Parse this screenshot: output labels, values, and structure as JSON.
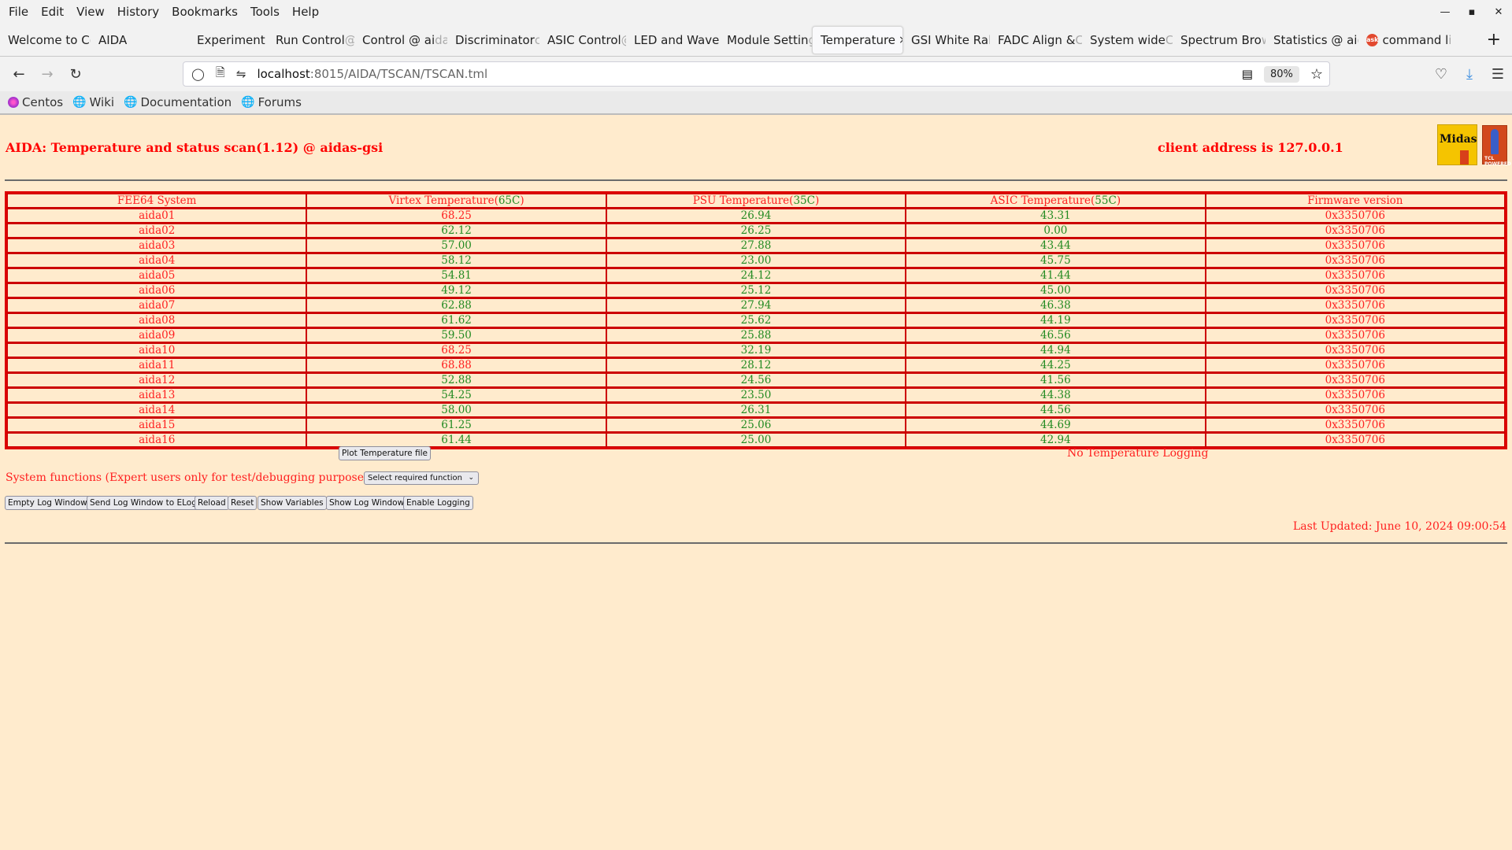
{
  "menubar": {
    "items": [
      "File",
      "Edit",
      "View",
      "History",
      "Bookmarks",
      "Tools",
      "Help"
    ],
    "window_controls": [
      "minimize",
      "maximize",
      "close"
    ]
  },
  "tabs": [
    {
      "label": "Welcome to C",
      "fade": "e"
    },
    {
      "label": "AIDA",
      "fade": ""
    },
    {
      "label": "Experiment Co",
      "fade": "r"
    },
    {
      "label": "Run Control ",
      "fade": "@"
    },
    {
      "label": "Control @ ai",
      "fade": "da"
    },
    {
      "label": "Discriminator ",
      "fade": "c"
    },
    {
      "label": "ASIC Control ",
      "fade": "@"
    },
    {
      "label": "LED and Wave",
      "fade": "f"
    },
    {
      "label": "Module Settin",
      "fade": "g"
    },
    {
      "label": "Temperature",
      "fade": "",
      "active": true
    },
    {
      "label": "GSI White Ra",
      "fade": "bb"
    },
    {
      "label": "FADC Align & ",
      "fade": "C"
    },
    {
      "label": "System wide ",
      "fade": "C"
    },
    {
      "label": "Spectrum Bro",
      "fade": "w"
    },
    {
      "label": "Statistics @ ai",
      "fade": "c"
    },
    {
      "label": "command l",
      "fade": "i",
      "icon": "ask"
    }
  ],
  "navbar": {
    "url_host": "localhost",
    "url_path": ":8015/AIDA/TSCAN/TSCAN.tml",
    "zoom": "80%"
  },
  "bookmarks": [
    "Centos",
    "Wiki",
    "Documentation",
    "Forums"
  ],
  "page": {
    "title": "AIDA: Temperature and status scan(1.12) @ aidas-gsi",
    "client_address": "client address is 127.0.0.1",
    "logo_midas": "Midas",
    "logo_tcl": "TCL POWERED",
    "table": {
      "headers": [
        {
          "text": "FEE64 System",
          "suffix": ""
        },
        {
          "text": "Virtex Temperature(",
          "suffix": "65C",
          "close": ")"
        },
        {
          "text": "PSU Temperature(",
          "suffix": "35C",
          "close": ")"
        },
        {
          "text": "ASIC Temperature(",
          "suffix": "55C",
          "close": ")"
        },
        {
          "text": "Firmware version",
          "suffix": ""
        }
      ],
      "rows": [
        {
          "name": "aida01",
          "virtex": "68.25",
          "psu": "26.94",
          "asic": "43.31",
          "fw": "0x3350706",
          "virtex_alarm": true
        },
        {
          "name": "aida02",
          "virtex": "62.12",
          "psu": "26.25",
          "asic": "0.00",
          "fw": "0x3350706",
          "virtex_alarm": false
        },
        {
          "name": "aida03",
          "virtex": "57.00",
          "psu": "27.88",
          "asic": "43.44",
          "fw": "0x3350706",
          "virtex_alarm": false
        },
        {
          "name": "aida04",
          "virtex": "58.12",
          "psu": "23.00",
          "asic": "45.75",
          "fw": "0x3350706",
          "virtex_alarm": false
        },
        {
          "name": "aida05",
          "virtex": "54.81",
          "psu": "24.12",
          "asic": "41.44",
          "fw": "0x3350706",
          "virtex_alarm": false
        },
        {
          "name": "aida06",
          "virtex": "49.12",
          "psu": "25.12",
          "asic": "45.00",
          "fw": "0x3350706",
          "virtex_alarm": false
        },
        {
          "name": "aida07",
          "virtex": "62.88",
          "psu": "27.94",
          "asic": "46.38",
          "fw": "0x3350706",
          "virtex_alarm": false
        },
        {
          "name": "aida08",
          "virtex": "61.62",
          "psu": "25.62",
          "asic": "44.19",
          "fw": "0x3350706",
          "virtex_alarm": false
        },
        {
          "name": "aida09",
          "virtex": "59.50",
          "psu": "25.88",
          "asic": "46.56",
          "fw": "0x3350706",
          "virtex_alarm": false
        },
        {
          "name": "aida10",
          "virtex": "68.25",
          "psu": "32.19",
          "asic": "44.94",
          "fw": "0x3350706",
          "virtex_alarm": true
        },
        {
          "name": "aida11",
          "virtex": "68.88",
          "psu": "28.12",
          "asic": "44.25",
          "fw": "0x3350706",
          "virtex_alarm": true
        },
        {
          "name": "aida12",
          "virtex": "52.88",
          "psu": "24.56",
          "asic": "41.56",
          "fw": "0x3350706",
          "virtex_alarm": false
        },
        {
          "name": "aida13",
          "virtex": "54.25",
          "psu": "23.50",
          "asic": "44.38",
          "fw": "0x3350706",
          "virtex_alarm": false
        },
        {
          "name": "aida14",
          "virtex": "58.00",
          "psu": "26.31",
          "asic": "44.56",
          "fw": "0x3350706",
          "virtex_alarm": false
        },
        {
          "name": "aida15",
          "virtex": "61.25",
          "psu": "25.06",
          "asic": "44.69",
          "fw": "0x3350706",
          "virtex_alarm": false
        },
        {
          "name": "aida16",
          "virtex": "61.44",
          "psu": "25.00",
          "asic": "42.94",
          "fw": "0x3350706",
          "virtex_alarm": false
        }
      ]
    },
    "plot_button": "Plot Temperature file",
    "logging_status": "No Temperature Logging",
    "system_functions_label": "System functions (Expert users only for test/debugging purposes!!!)",
    "system_functions_select": "Select required function",
    "buttons": [
      "Empty Log Window",
      "Send Log Window to ELog",
      "Reload",
      "Reset",
      "Show Variables",
      "Show Log Window",
      "Enable Logging"
    ],
    "last_updated": "Last Updated: June 10, 2024 09:00:54"
  },
  "colors": {
    "page_bg": "#ffebcd",
    "alarm": "#ff2020",
    "ok": "#228b22",
    "table_border": "#dd0000"
  }
}
